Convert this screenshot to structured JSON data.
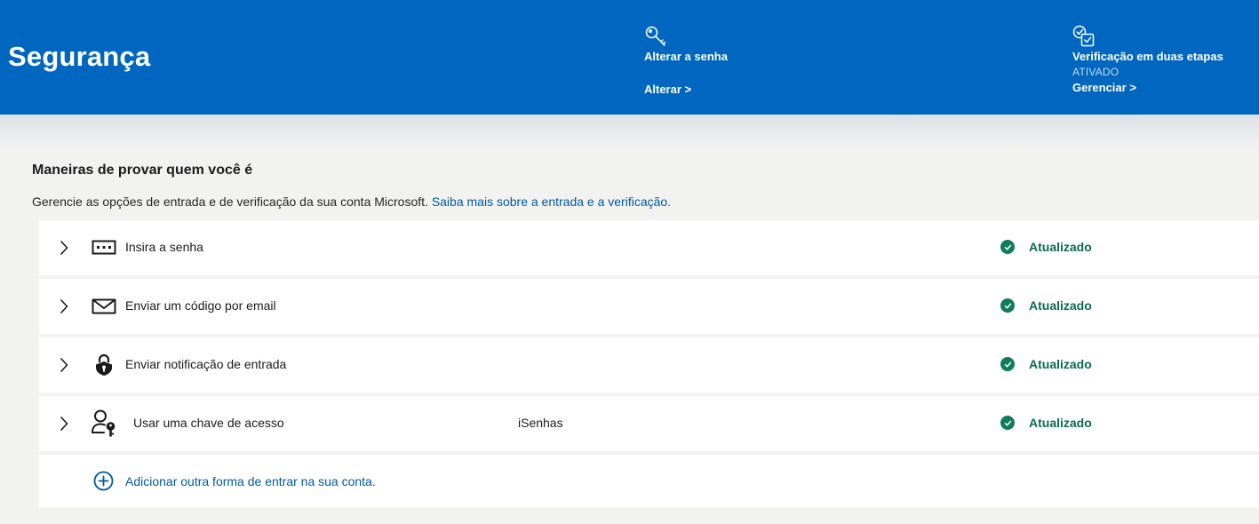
{
  "header": {
    "title": "Segurança",
    "password": {
      "icon": "key-icon",
      "title": "Alterar a senha",
      "link": "Alterar >"
    },
    "two_step": {
      "icon": "shield-check-icon",
      "title": "Verificação em duas etapas",
      "status": "ATIVADO",
      "link": "Gerenciar >"
    }
  },
  "section": {
    "title": "Maneiras de provar quem você é",
    "description": "Gerencie as opções de entrada e de verificação da sua conta Microsoft.",
    "learn_more": "Saiba mais sobre a entrada e a verificação."
  },
  "methods": [
    {
      "icon": "password-icon",
      "label": "Insira a senha",
      "detail": "",
      "status": "Atualizado"
    },
    {
      "icon": "email-icon",
      "label": "Enviar um código por email",
      "detail": "",
      "status": "Atualizado"
    },
    {
      "icon": "lock-notification-icon",
      "label": "Enviar notificação de entrada",
      "detail": "",
      "status": "Atualizado"
    },
    {
      "icon": "passkey-icon",
      "label": "Usar uma chave de acesso",
      "detail": "iSenhas",
      "status": "Atualizado"
    }
  ],
  "add_method": {
    "icon": "plus-circle-icon",
    "label": "Adicionar outra forma de entrar na sua conta."
  },
  "colors": {
    "header_bg": "#0067c0",
    "status_green": "#107c5d",
    "link_blue": "#005a9e",
    "page_bg": "#f2f2f1"
  }
}
